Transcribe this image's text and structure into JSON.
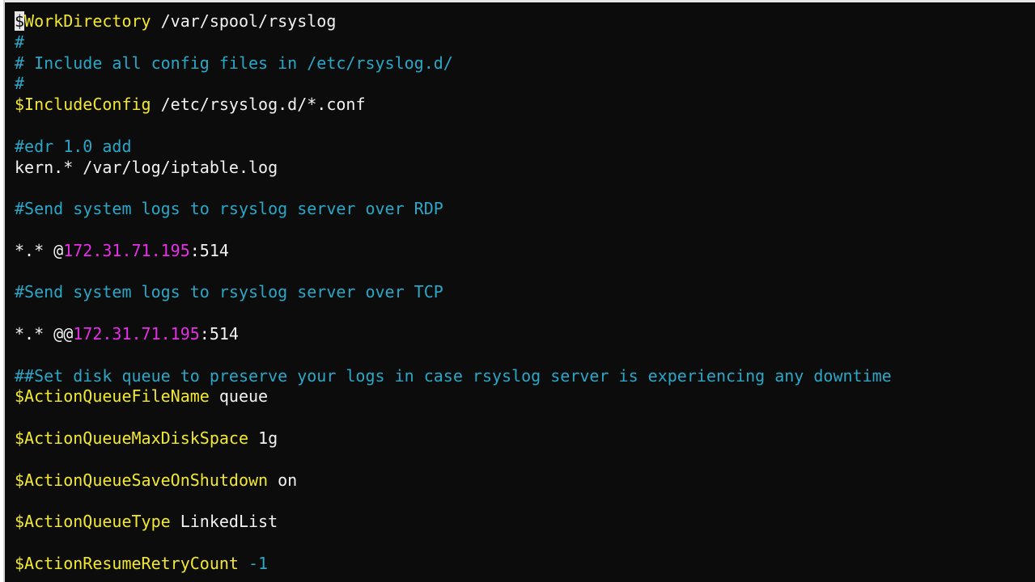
{
  "terminal": {
    "lines": [
      {
        "segments": [
          {
            "text": "$",
            "color": "cursor"
          },
          {
            "text": "WorkDirectory",
            "color": "yellow"
          },
          {
            "text": " /var/spool/rsyslog",
            "color": "white"
          }
        ]
      },
      {
        "segments": [
          {
            "text": "#",
            "color": "cyan"
          }
        ]
      },
      {
        "segments": [
          {
            "text": "# Include all config files in /etc/rsyslog.d/",
            "color": "cyan"
          }
        ]
      },
      {
        "segments": [
          {
            "text": "#",
            "color": "cyan"
          }
        ]
      },
      {
        "segments": [
          {
            "text": "$IncludeConfig",
            "color": "yellow"
          },
          {
            "text": " /etc/rsyslog.d/*.conf",
            "color": "white"
          }
        ]
      },
      {
        "segments": []
      },
      {
        "segments": [
          {
            "text": "#edr 1.0 add",
            "color": "cyan"
          }
        ]
      },
      {
        "segments": [
          {
            "text": "kern.* /var/log/iptable.log",
            "color": "white"
          }
        ]
      },
      {
        "segments": []
      },
      {
        "segments": [
          {
            "text": "#Send system logs to rsyslog server over RDP",
            "color": "cyan"
          }
        ]
      },
      {
        "segments": []
      },
      {
        "segments": [
          {
            "text": "*.* @",
            "color": "white"
          },
          {
            "text": "172.31.71.195",
            "color": "magenta"
          },
          {
            "text": ":514",
            "color": "white"
          }
        ]
      },
      {
        "segments": []
      },
      {
        "segments": [
          {
            "text": "#Send system logs to rsyslog server over TCP",
            "color": "cyan"
          }
        ]
      },
      {
        "segments": []
      },
      {
        "segments": [
          {
            "text": "*.* @@",
            "color": "white"
          },
          {
            "text": "172.31.71.195",
            "color": "magenta"
          },
          {
            "text": ":514",
            "color": "white"
          }
        ]
      },
      {
        "segments": []
      },
      {
        "segments": [
          {
            "text": "##Set disk queue to preserve your logs in case rsyslog server is experiencing any downtime",
            "color": "cyan"
          }
        ]
      },
      {
        "segments": [
          {
            "text": "$ActionQueueFileName",
            "color": "yellow"
          },
          {
            "text": " queue",
            "color": "white"
          }
        ]
      },
      {
        "segments": []
      },
      {
        "segments": [
          {
            "text": "$ActionQueueMaxDiskSpace",
            "color": "yellow"
          },
          {
            "text": " 1g",
            "color": "white"
          }
        ]
      },
      {
        "segments": []
      },
      {
        "segments": [
          {
            "text": "$ActionQueueSaveOnShutdown",
            "color": "yellow"
          },
          {
            "text": " on",
            "color": "white"
          }
        ]
      },
      {
        "segments": []
      },
      {
        "segments": [
          {
            "text": "$ActionQueueType",
            "color": "yellow"
          },
          {
            "text": " LinkedList",
            "color": "white"
          }
        ]
      },
      {
        "segments": []
      },
      {
        "segments": [
          {
            "text": "$ActionResumeRetryCount",
            "color": "yellow"
          },
          {
            "text": " -1",
            "color": "cyan"
          }
        ]
      }
    ]
  },
  "colors": {
    "background": "#0c0c0c",
    "white": "#f2f2f2",
    "yellow": "#f2e830",
    "cyan": "#2aa7c7",
    "magenta": "#e62ee6"
  }
}
